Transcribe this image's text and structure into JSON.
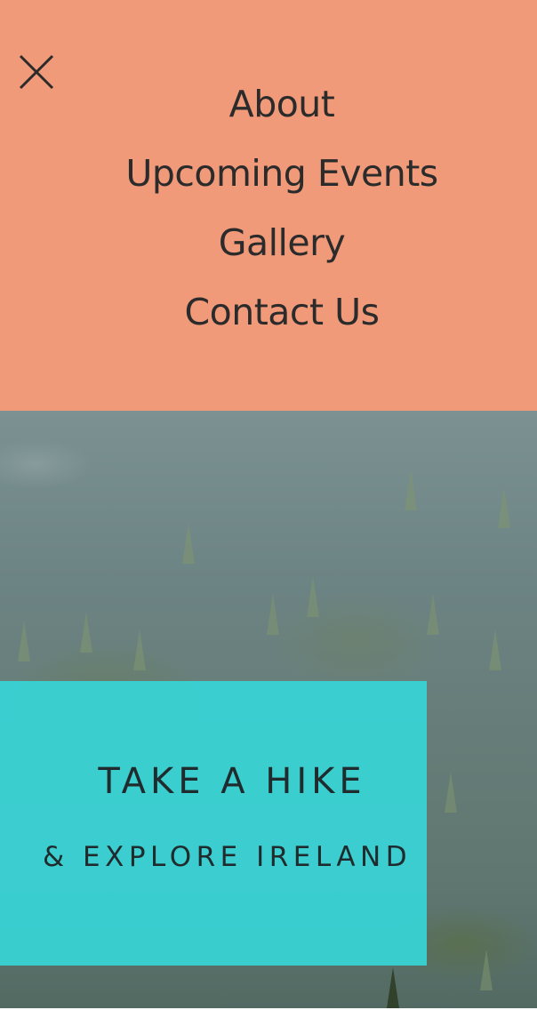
{
  "menu": {
    "close_icon": "close-icon",
    "background_color": "#f09a79",
    "items": [
      {
        "label": "About"
      },
      {
        "label": "Upcoming Events"
      },
      {
        "label": "Gallery"
      },
      {
        "label": "Contact Us"
      }
    ]
  },
  "hero": {
    "title": "TAKE A HIKE",
    "subtitle": "& EXPLORE IRELAND",
    "box_color": "#38d4d6",
    "image": "forested-mountain-slope"
  }
}
